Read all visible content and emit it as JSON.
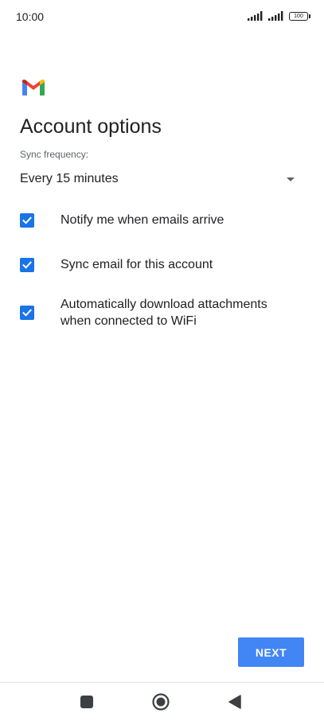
{
  "status_bar": {
    "time": "10:00",
    "battery": "100"
  },
  "app": {
    "logo_icon": "gmail-icon"
  },
  "page": {
    "title": "Account options"
  },
  "sync": {
    "label": "Sync frequency:",
    "value": "Every 15 minutes"
  },
  "options": [
    {
      "label": "Notify me when emails arrive",
      "checked": true
    },
    {
      "label": "Sync email for this account",
      "checked": true
    },
    {
      "label": "Automatically download attachments when connected to WiFi",
      "checked": true
    }
  ],
  "actions": {
    "next_label": "NEXT"
  },
  "colors": {
    "accent": "#1a73e8",
    "button": "#4285f4"
  },
  "nav": {
    "recents_icon": "square-icon",
    "home_icon": "circle-home-icon",
    "back_icon": "back-triangle-icon"
  }
}
